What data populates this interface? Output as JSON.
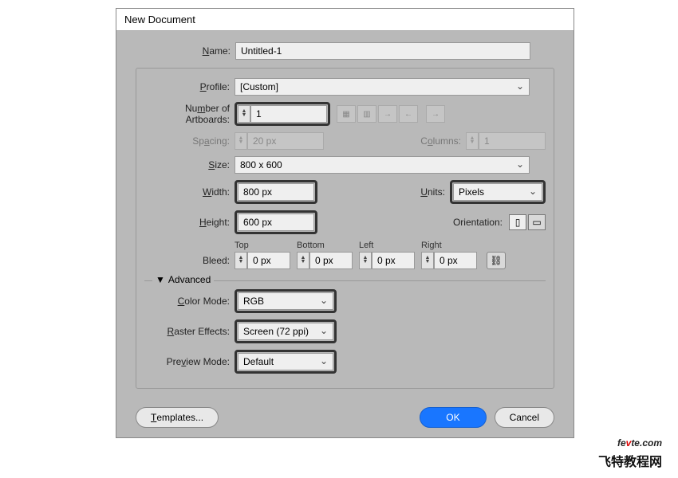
{
  "dialog": {
    "title": "New Document"
  },
  "labels": {
    "name": "Name:",
    "profile": "Profile:",
    "artboards": "Number of Artboards:",
    "spacing": "Spacing:",
    "columns": "Columns:",
    "size": "Size:",
    "width": "Width:",
    "height": "Height:",
    "units": "Units:",
    "orientation": "Orientation:",
    "bleed": "Bleed:",
    "top": "Top",
    "bottom": "Bottom",
    "left": "Left",
    "right": "Right",
    "advanced": "Advanced",
    "colormode": "Color Mode:",
    "raster": "Raster Effects:",
    "preview": "Preview Mode:"
  },
  "values": {
    "name": "Untitled-1",
    "profile": "[Custom]",
    "artboards": "1",
    "spacing": "20 px",
    "columns": "1",
    "size": "800 x 600",
    "width": "800 px",
    "height": "600 px",
    "units": "Pixels",
    "bleed_top": "0 px",
    "bleed_bottom": "0 px",
    "bleed_left": "0 px",
    "bleed_right": "0 px",
    "colormode": "RGB",
    "raster": "Screen (72 ppi)",
    "preview": "Default"
  },
  "buttons": {
    "templates": "Templates...",
    "ok": "OK",
    "cancel": "Cancel"
  },
  "watermark": {
    "domain_a": "fe",
    "domain_b": "v",
    "domain_c": "te",
    "domain_d": ".com",
    "cn": "飞特教程网"
  }
}
